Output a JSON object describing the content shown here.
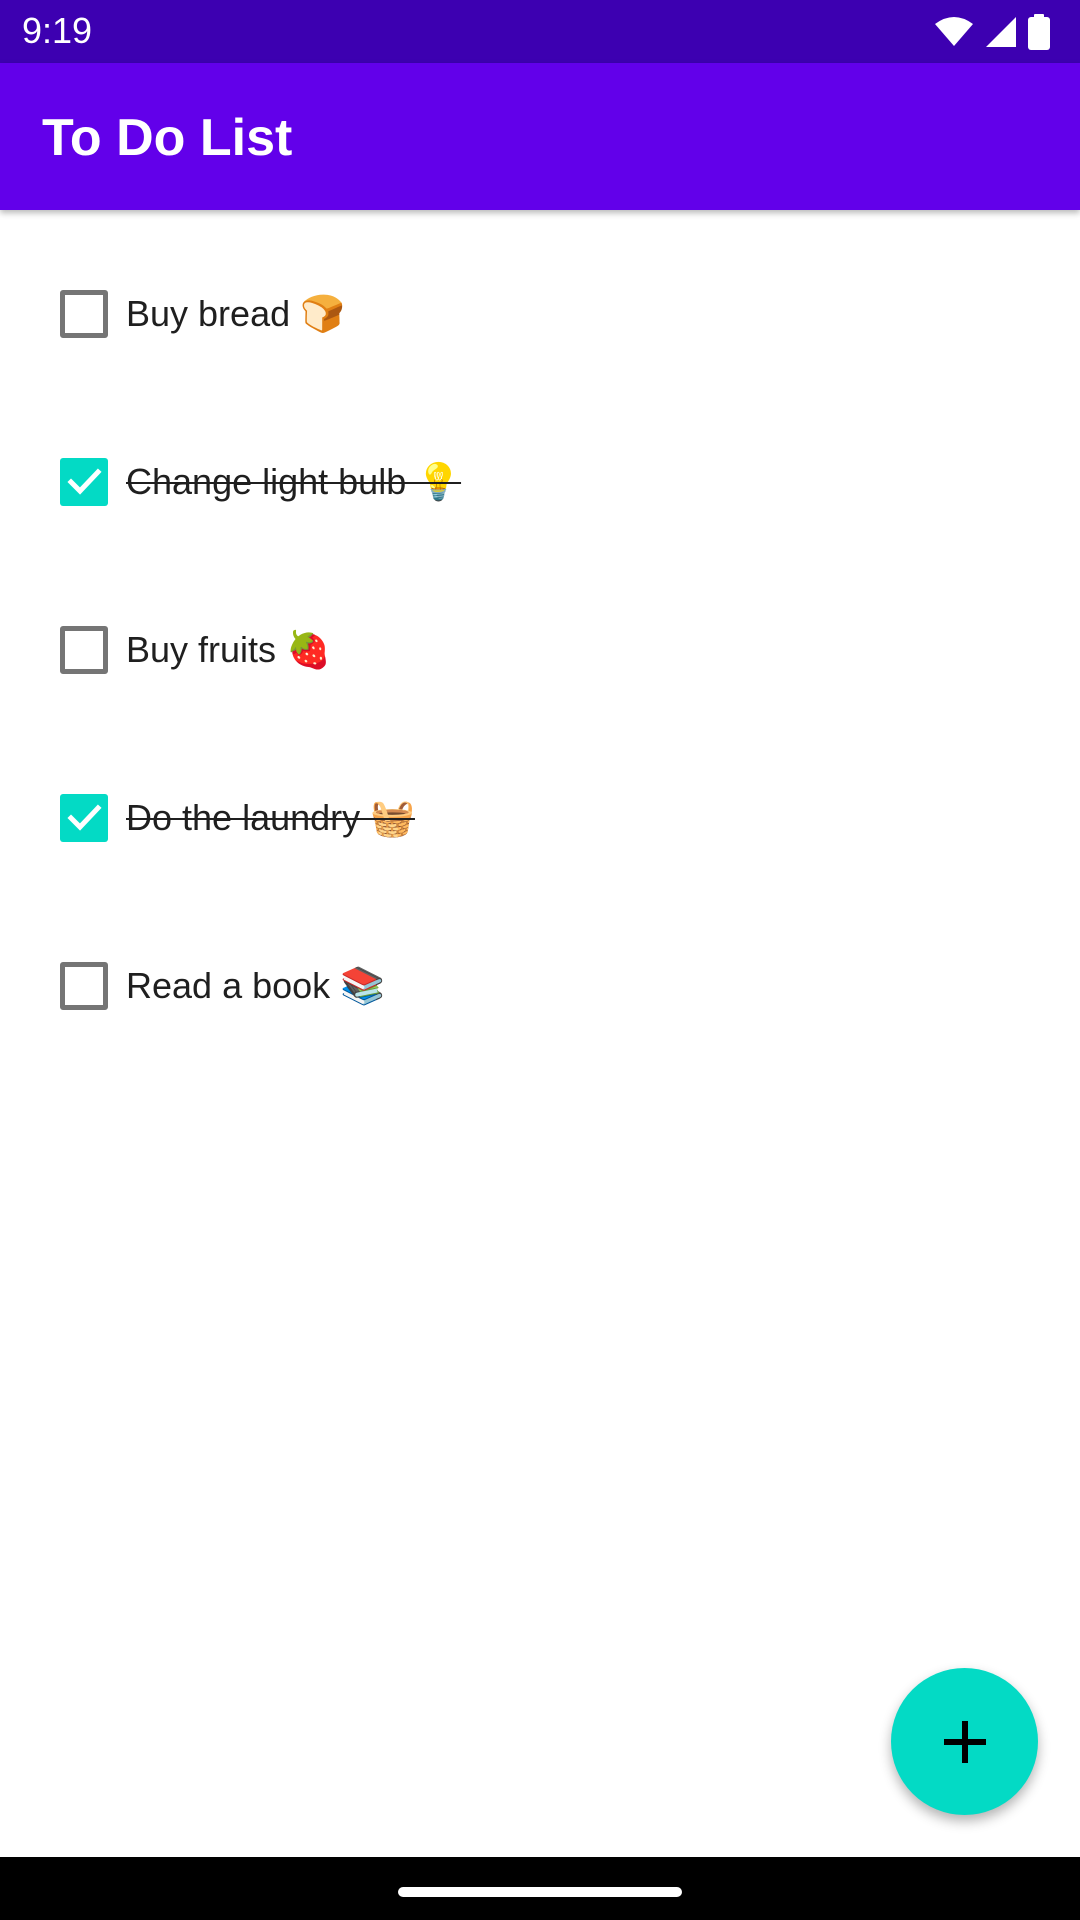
{
  "status_bar": {
    "time": "9:19",
    "icons": [
      "wifi-icon",
      "cellular-signal-icon",
      "battery-icon"
    ]
  },
  "app_bar": {
    "title": "To Do List"
  },
  "todos": [
    {
      "label": "Buy bread 🍞",
      "checked": false
    },
    {
      "label": "Change light bulb 💡",
      "checked": true
    },
    {
      "label": "Buy fruits 🍓",
      "checked": false
    },
    {
      "label": "Do the laundry 🧺",
      "checked": true
    },
    {
      "label": "Read a book 📚",
      "checked": false
    }
  ],
  "fab": {
    "icon": "plus-icon"
  },
  "colors": {
    "status_bar": "#3d00b1",
    "primary": "#6200ea",
    "accent": "#03dac5",
    "checkbox_unchecked_border": "#757575"
  }
}
